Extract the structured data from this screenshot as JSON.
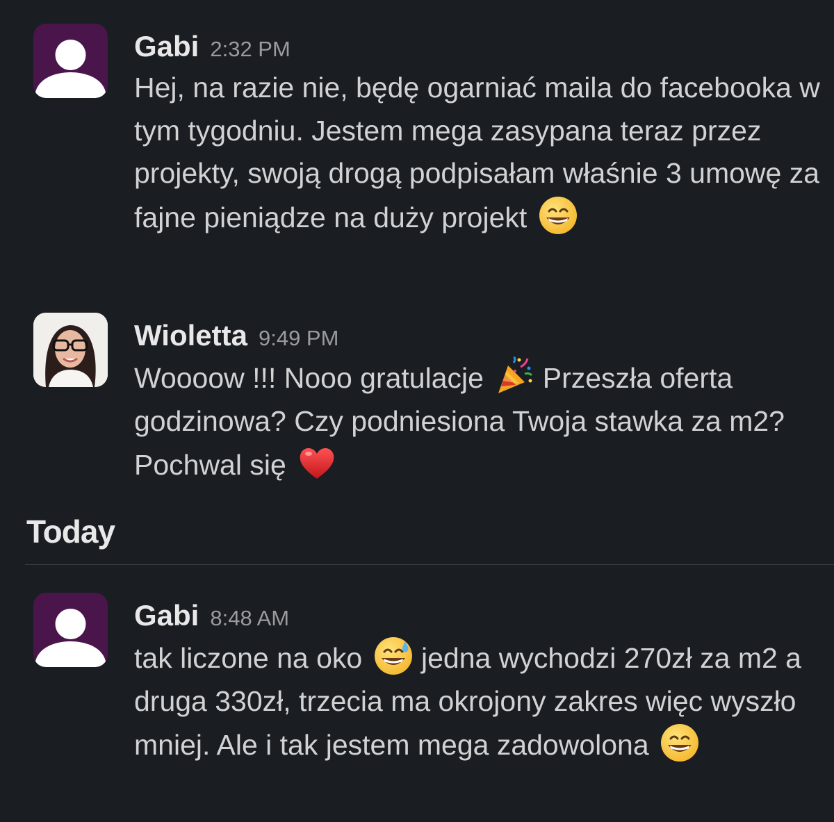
{
  "messages": [
    {
      "sender": "Gabi",
      "time": "2:32 PM",
      "avatar": "default-user-avatar",
      "text": "Hej, na razie nie, będę ogarniać maila do facebooka w tym tygodniu. Jestem mega zasypana teraz przez projekty, swoją drogą podpisałam właśnie 3 umowę za fajne pieniądze na duży projekt",
      "emoji": "grinning-face-emoji"
    },
    {
      "sender": "Wioletta",
      "time": "9:49 PM",
      "avatar": "profile-photo",
      "text_before": "Woooow !!! Nooo gratulacje",
      "emoji_mid": "party-popper-emoji",
      "text_after": "Przeszła oferta godzinowa? Czy podniesiona Twoja stawka za m2? Pochwal się",
      "emoji_end": "red-heart-emoji"
    },
    {
      "sender": "Gabi",
      "time": "8:48 AM",
      "avatar": "default-user-avatar",
      "text_before": "tak liczone na oko",
      "emoji_mid": "grinning-face-with-sweat-emoji",
      "text_after": "jedna wychodzi 270zł za m2 a druga 330zł, trzecia ma okrojony zakres więc wyszło mniej. Ale i tak jestem mega zadowolona",
      "emoji_end": "grinning-face-emoji"
    }
  ],
  "day_divider": {
    "label": "Today"
  },
  "colors": {
    "background": "#1a1d21",
    "default_avatar": "#4a154b",
    "text": "#d1d2d3",
    "timestamp": "#9a9b9e"
  }
}
